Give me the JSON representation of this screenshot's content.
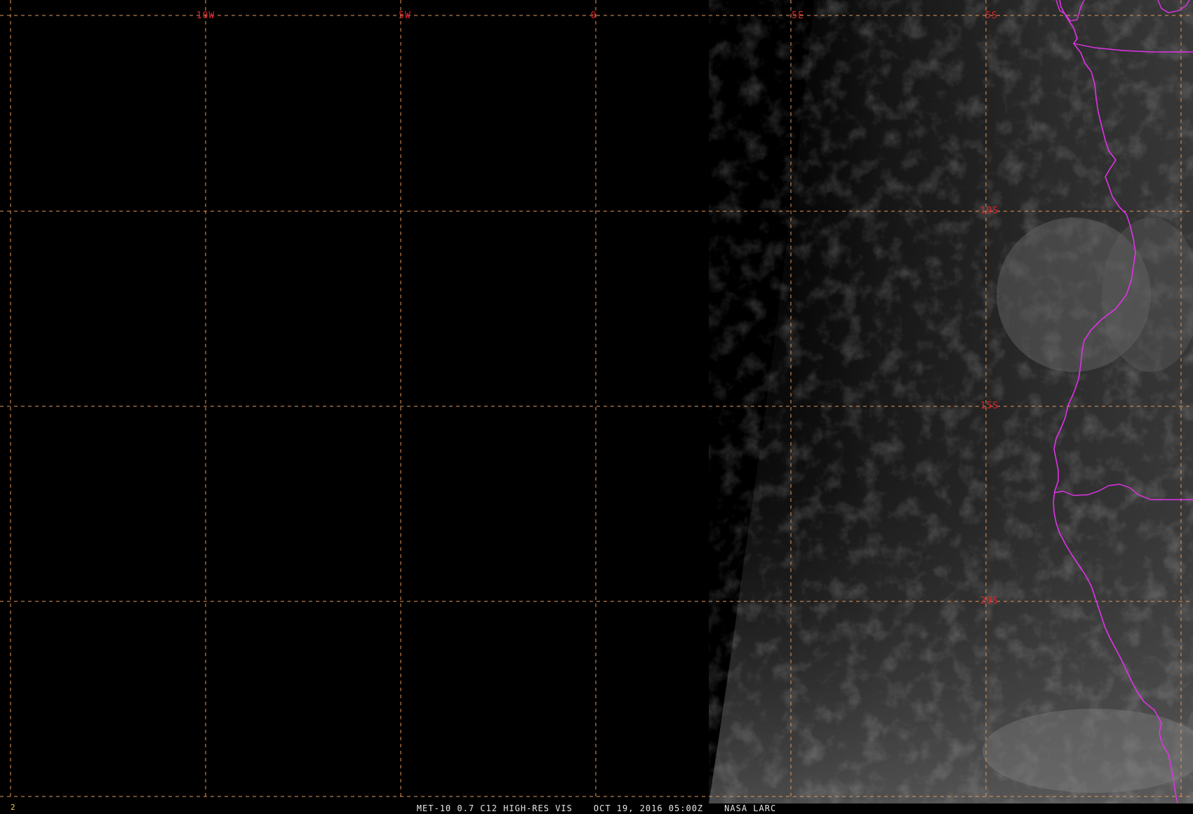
{
  "grid": {
    "longitude_labels": [
      "10W",
      "5W",
      "0",
      "5E"
    ],
    "latitude_labels": [
      "5S",
      "10S",
      "15S",
      "20S"
    ],
    "line_color": "#e3985a",
    "label_color": "#e0232a"
  },
  "overlay": {
    "coastline_color": "#e033e8"
  },
  "footer": {
    "product": "MET-10 0.7 C12 HIGH-RES VIS",
    "datetime": "OCT 19, 2016 05:00Z",
    "source": "NASA LARC"
  },
  "frame_number": "2"
}
